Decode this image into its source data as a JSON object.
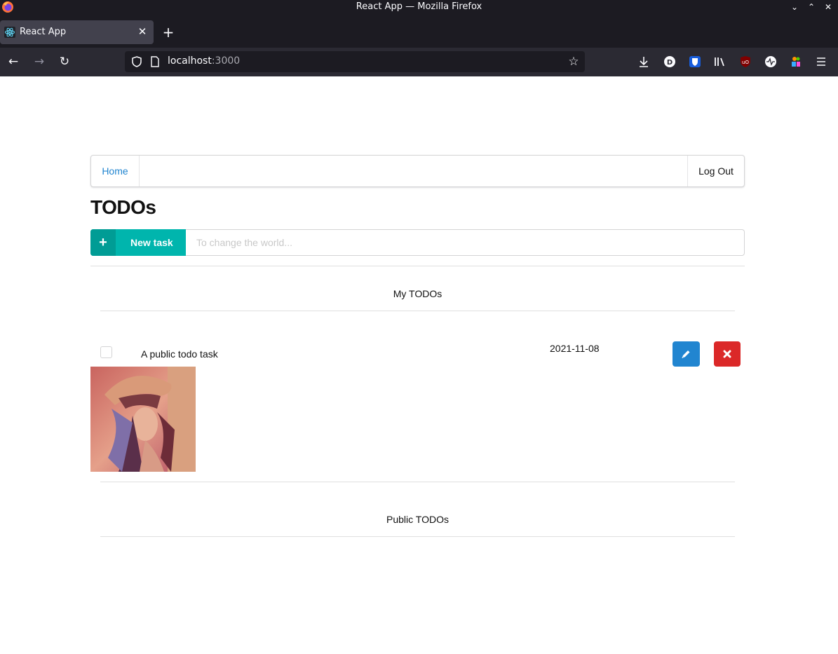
{
  "window": {
    "title": "React App — Mozilla Firefox"
  },
  "tabs": [
    {
      "label": "React App",
      "active": true
    }
  ],
  "address_bar": {
    "host": "localhost",
    "port": ":3000"
  },
  "extensions": [
    "download-icon",
    "duckduckgo-icon",
    "bitwarden-icon",
    "library-icon",
    "ublock-icon",
    "pulse-icon",
    "multi-account-icon",
    "menu-icon"
  ],
  "nav_menu": {
    "home_label": "Home",
    "logout_label": "Log Out"
  },
  "page": {
    "title": "TODOs",
    "new_task_label": "New task",
    "new_task_placeholder": "To change the world..."
  },
  "sections": {
    "my_todos_label": "My TODOs",
    "public_todos_label": "Public TODOs"
  },
  "todos": [
    {
      "text": "A public todo task",
      "date": "2021-11-08",
      "checked": false,
      "has_image": true
    }
  ],
  "colors": {
    "teal": "#00b5ad",
    "blue": "#2185d0",
    "red": "#db2828",
    "link": "#2185d0"
  }
}
